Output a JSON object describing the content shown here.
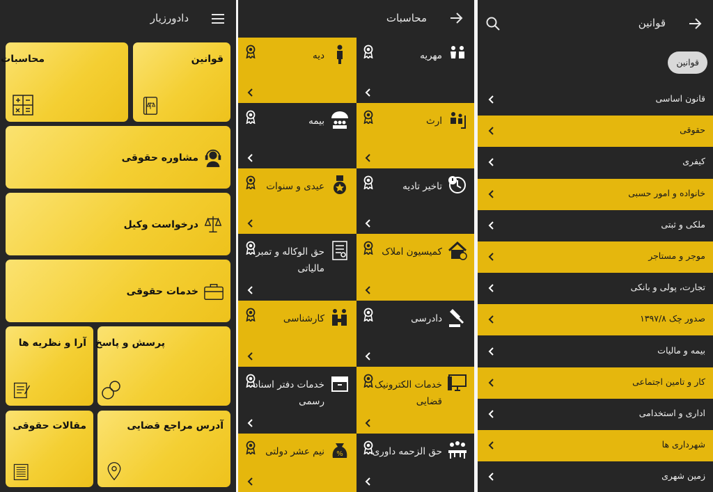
{
  "screen_home": {
    "app_title": "دادورزیار",
    "tiles": {
      "laws": "قوانین",
      "calculations": "محاسبات",
      "legal_advice": "مشاوره حقوقی",
      "lawyer_request": "درخواست وکیل",
      "legal_services": "خدمات حقوقی",
      "qa": "پرسش و پاسخ",
      "opinions": "آرا و نظریه ها",
      "court_addresses": "آدرس مراجع قضایی",
      "articles": "مقالات حقوقی"
    }
  },
  "screen_calc": {
    "title": "محاسبات",
    "cells": [
      {
        "label": "مهریه"
      },
      {
        "label": "دیه"
      },
      {
        "label": "ارث"
      },
      {
        "label": "بیمه"
      },
      {
        "label": "تاخیر تادیه"
      },
      {
        "label": "عیدی و سنوات"
      },
      {
        "label": "کمیسیون املاک"
      },
      {
        "label": "حق الوکاله و تمبر مالیاتی"
      },
      {
        "label": "دادرسی"
      },
      {
        "label": "کارشناسی"
      },
      {
        "label": "خدمات الکترونیک قضایی"
      },
      {
        "label": "خدمات دفتر اسناد رسمی"
      },
      {
        "label": "حق الزحمه داوری"
      },
      {
        "label": "نیم عشر دولتی"
      }
    ]
  },
  "screen_laws": {
    "title": "قوانین",
    "chip": "قوانین",
    "rows": [
      "قانون اساسی",
      "حقوقی",
      "کیفری",
      "خانواده و امور حسبی",
      "ملکی و ثبتی",
      "موجر و مستاجر",
      "تجارت، پولی و بانکی",
      "صدور چک ۱۳۹۷/۸",
      "بیمه و مالیات",
      "کار و تامین اجتماعی",
      "اداری و استخدامی",
      "شهرداری ها",
      "زمین شهری"
    ]
  },
  "colors": {
    "accent": "#e5b70d",
    "tile": "#f4cf33",
    "dark": "#262626"
  },
  "icons": [
    "menu-icon",
    "back-arrow-icon",
    "search-icon",
    "medal-icon",
    "chevron-left-icon"
  ]
}
